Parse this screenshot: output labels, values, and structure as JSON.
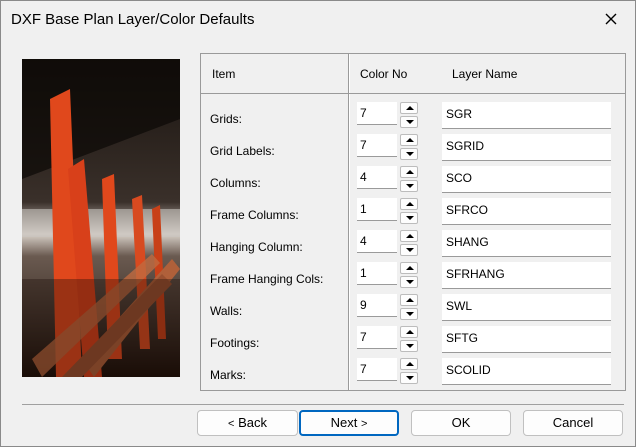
{
  "window": {
    "title": "DXF Base Plan Layer/Color Defaults"
  },
  "headers": {
    "item": "Item",
    "color_no": "Color No",
    "layer_name": "Layer Name"
  },
  "rows": [
    {
      "label": "Grids:",
      "color": "7",
      "layer": "SGR"
    },
    {
      "label": "Grid Labels:",
      "color": "7",
      "layer": "SGRID"
    },
    {
      "label": "Columns:",
      "color": "4",
      "layer": "SCO"
    },
    {
      "label": "Frame Columns:",
      "color": "1",
      "layer": "SFRCO"
    },
    {
      "label": "Hanging Column:",
      "color": "4",
      "layer": "SHANG"
    },
    {
      "label": "Frame Hanging Cols:",
      "color": "1",
      "layer": "SFRHANG"
    },
    {
      "label": "Walls:",
      "color": "9",
      "layer": "SWL"
    },
    {
      "label": "Footings:",
      "color": "7",
      "layer": "SFTG"
    },
    {
      "label": "Marks:",
      "color": "7",
      "layer": "SCOLID"
    }
  ],
  "buttons": {
    "back": "Back",
    "back_prefix": "<",
    "next": "Next",
    "next_suffix": ">",
    "ok": "OK",
    "cancel": "Cancel"
  },
  "icons": {
    "close": "close-icon",
    "spin_up": "chevron-up-icon",
    "spin_down": "chevron-down-icon"
  },
  "colors": {
    "default_button_border": "#0067c0",
    "accent_steel": "#e0481c"
  }
}
